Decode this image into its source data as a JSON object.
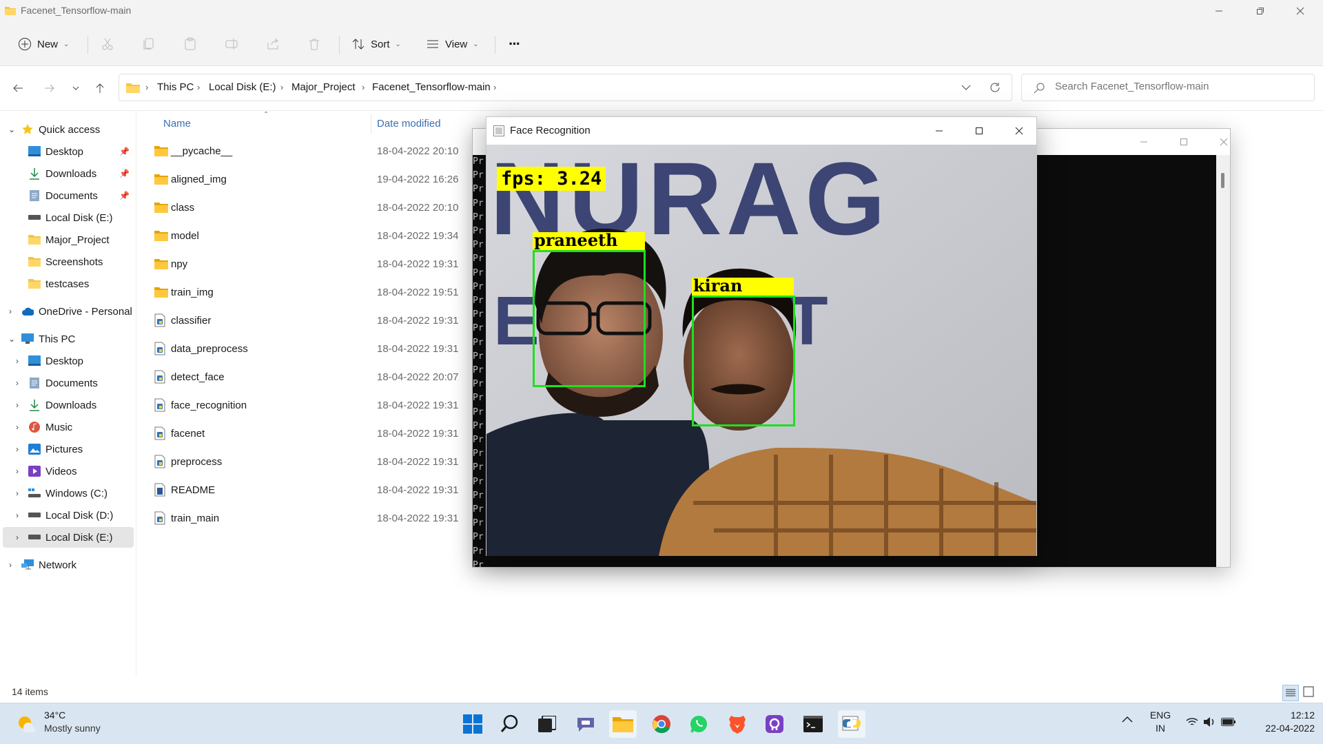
{
  "window": {
    "title": "Facenet_Tensorflow-main"
  },
  "toolbar": {
    "new_label": "New",
    "sort_label": "Sort",
    "view_label": "View",
    "more_label": "···"
  },
  "address": {
    "crumbs": [
      "This PC",
      "Local Disk (E:)",
      "Major_Project",
      "Facenet_Tensorflow-main"
    ],
    "search_placeholder": "Search Facenet_Tensorflow-main"
  },
  "nav": {
    "quick_access": "Quick access",
    "quick_items": [
      "Desktop",
      "Downloads",
      "Documents",
      "Local Disk (E:)",
      "Major_Project",
      "Screenshots",
      "testcases"
    ],
    "onedrive": "OneDrive - Personal",
    "this_pc": "This PC",
    "pc_items": [
      "Desktop",
      "Documents",
      "Downloads",
      "Music",
      "Pictures",
      "Videos",
      "Windows (C:)",
      "Local Disk (D:)",
      "Local Disk (E:)"
    ],
    "network": "Network"
  },
  "files": {
    "col_name": "Name",
    "col_date": "Date modified",
    "rows": [
      {
        "name": "__pycache__",
        "date": "18-04-2022 20:10",
        "type": "folder"
      },
      {
        "name": "aligned_img",
        "date": "19-04-2022 16:26",
        "type": "folder"
      },
      {
        "name": "class",
        "date": "18-04-2022 20:10",
        "type": "folder"
      },
      {
        "name": "model",
        "date": "18-04-2022 19:34",
        "type": "folder"
      },
      {
        "name": "npy",
        "date": "18-04-2022 19:31",
        "type": "folder"
      },
      {
        "name": "train_img",
        "date": "18-04-2022 19:51",
        "type": "folder"
      },
      {
        "name": "classifier",
        "date": "18-04-2022 19:31",
        "type": "python"
      },
      {
        "name": "data_preprocess",
        "date": "18-04-2022 19:31",
        "type": "python"
      },
      {
        "name": "detect_face",
        "date": "18-04-2022 20:07",
        "type": "python"
      },
      {
        "name": "face_recognition",
        "date": "18-04-2022 19:31",
        "type": "python"
      },
      {
        "name": "facenet",
        "date": "18-04-2022 19:31",
        "type": "python"
      },
      {
        "name": "preprocess",
        "date": "18-04-2022 19:31",
        "type": "python"
      },
      {
        "name": "README",
        "date": "18-04-2022 19:31",
        "type": "doc"
      },
      {
        "name": "train_main",
        "date": "18-04-2022 19:31",
        "type": "python"
      }
    ]
  },
  "status": {
    "item_count": "14 items"
  },
  "console": {
    "line_prefix": "Pr"
  },
  "face_window": {
    "title": "Face Recognition",
    "fps": "fps: 3.24",
    "faces": [
      "praneeth",
      "kiran"
    ],
    "banner_text": "NURAG",
    "banner_text2": "E  S I T"
  },
  "taskbar": {
    "weather_temp": "34°C",
    "weather_desc": "Mostly sunny",
    "lang1": "ENG",
    "lang2": "IN",
    "time": "12:12",
    "date": "22-04-2022"
  },
  "colors": {
    "accent": "#0067c0",
    "box": "#1ee01e",
    "label_bg": "#ffff00",
    "folder": "#f4c542"
  }
}
